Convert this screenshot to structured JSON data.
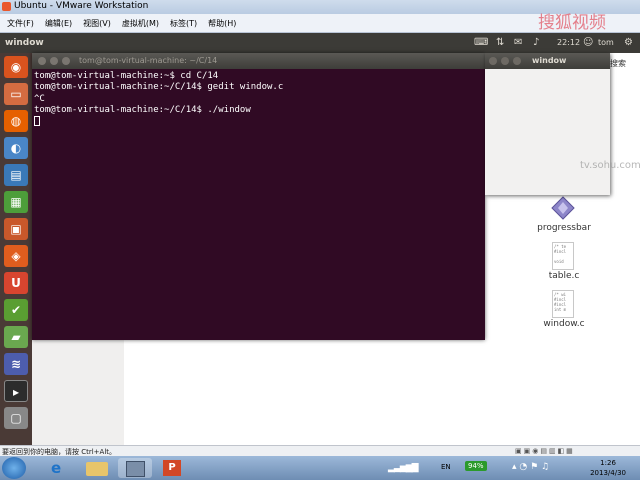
{
  "vmware": {
    "title": "Ubuntu - VMware Workstation",
    "menu": [
      "文件(F)",
      "编辑(E)",
      "视图(V)",
      "虚拟机(M)",
      "标签(T)",
      "帮助(H)"
    ],
    "status_hint": "要返回到你的电脑，请按 Ctrl+Alt。"
  },
  "ubuntu_panel": {
    "title": "window",
    "time": "22:12",
    "user": "tom",
    "watermark": "搜狐视频"
  },
  "terminal": {
    "title": "tom@tom-virtual-machine: ~/C/14",
    "lines": [
      "tom@tom-virtual-machine:~$ cd C/14",
      "tom@tom-virtual-machine:~/C/14$ gedit window.c",
      "^C",
      "tom@tom-virtual-machine:~/C/14$ ./window"
    ]
  },
  "app_window": {
    "title": "window"
  },
  "files": [
    {
      "name": "progressbar"
    },
    {
      "name": "table.c"
    },
    {
      "name": "window.c"
    }
  ],
  "watermark_url": "tv.sohu.com",
  "search_label": "搜索",
  "taskbar": {
    "lang": "EN",
    "battery": "94%",
    "time": "1:26",
    "date": "2013/4/30"
  }
}
